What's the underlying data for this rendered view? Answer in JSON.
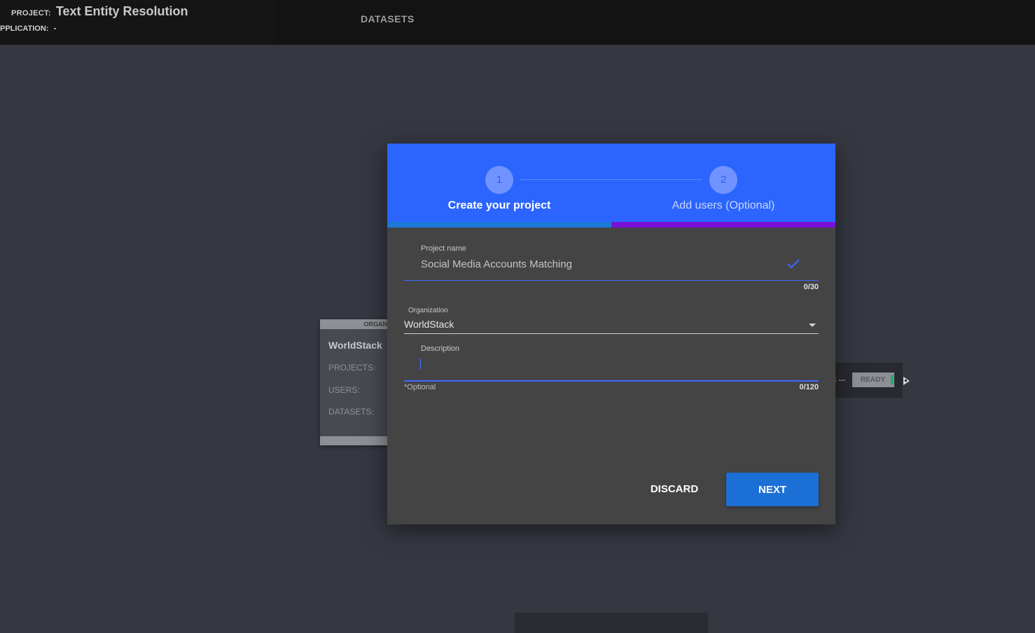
{
  "header": {
    "project_label": "PROJECT:",
    "project_name": "Text Entity Resolution",
    "application_label": "PPLICATION:",
    "application_value": "-",
    "nav_datasets": "DATASETS"
  },
  "background": {
    "org_card": {
      "header": "ORGAN",
      "name": "WorldStack",
      "projects_label": "PROJECTS:",
      "users_label": "USERS:",
      "datasets_label": "DATASETS:"
    },
    "dataset_card": {
      "truncated_text": "; ...",
      "status": "READY"
    }
  },
  "modal": {
    "steps": [
      {
        "number": "1",
        "label": "Create your project"
      },
      {
        "number": "2",
        "label": "Add users (Optional)"
      }
    ],
    "project_name": {
      "label": "Project name",
      "value": "Social Media Accounts Matching",
      "counter": "0/30"
    },
    "organization": {
      "label": "Organization",
      "value": "WorldStack"
    },
    "description": {
      "label": "Description",
      "value": "",
      "note": "*Optional",
      "counter": "0/120"
    },
    "buttons": {
      "discard": "DISCARD",
      "next": "NEXT"
    }
  },
  "colors": {
    "stepper_bg": "#2b65fe",
    "progress_step1": "#1d78d6",
    "progress_step2": "#7a10d8",
    "next_button": "#1c6fd4",
    "modal_bg": "#444444",
    "ready_indicator": "#1fae6b"
  },
  "icons": {
    "project_name_valid": "check-icon",
    "organization_dropdown": "chevron-down-icon",
    "dataset_open": "play-arrow-icon"
  }
}
